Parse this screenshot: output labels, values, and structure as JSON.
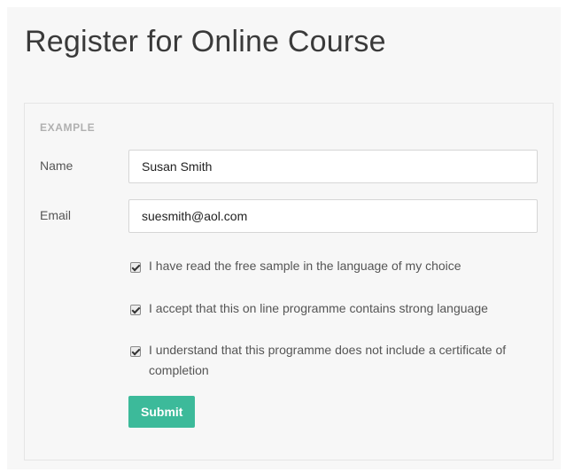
{
  "page": {
    "title": "Register for Online Course"
  },
  "form": {
    "section_label": "EXAMPLE",
    "name": {
      "label": "Name",
      "value": "Susan Smith"
    },
    "email": {
      "label": "Email",
      "value": "suesmith@aol.com"
    },
    "checkboxes": [
      {
        "label": "I have read the free sample in the language of my choice",
        "checked": true
      },
      {
        "label": "I accept that this on line programme contains strong language",
        "checked": true
      },
      {
        "label": "I understand that this programme does not include a certificate of completion",
        "checked": true
      }
    ],
    "submit_label": "Submit"
  },
  "colors": {
    "accent": "#3cba9a",
    "background": "#f7f7f7"
  },
  "icons": {
    "checkbox": "checkmark-icon"
  }
}
